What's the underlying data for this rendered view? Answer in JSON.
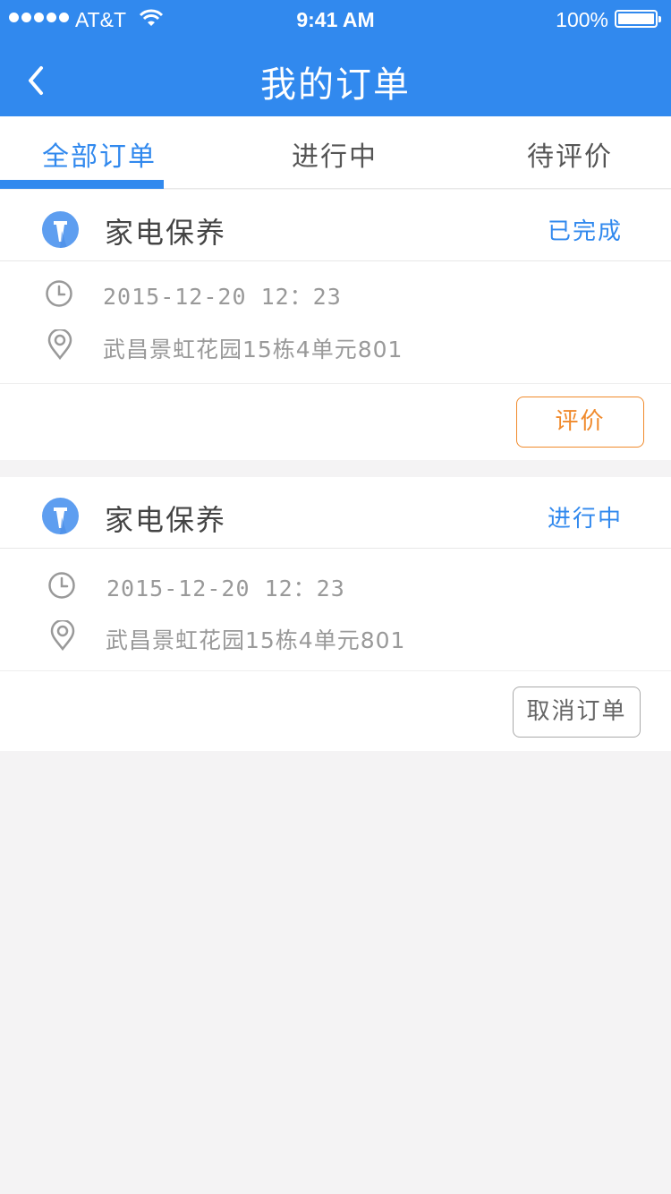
{
  "status_bar": {
    "carrier": "AT&T",
    "time": "9:41 AM",
    "battery": "100%"
  },
  "nav": {
    "title": "我的订单",
    "back_icon": "chevron-left-icon"
  },
  "tabs": [
    {
      "label": "全部订单",
      "active": true
    },
    {
      "label": "进行中",
      "active": false
    },
    {
      "label": "待评价",
      "active": false
    }
  ],
  "orders": [
    {
      "service": "家电保养",
      "status": "已完成",
      "datetime": "2015-12-20 12：23",
      "address": "武昌景虹花园15栋4单元801",
      "action": "评价"
    },
    {
      "service": "家电保养",
      "status": "进行中",
      "datetime": "2015-12-20 12：23",
      "address": "武昌景虹花园15栋4单元801",
      "action": "取消订单"
    }
  ],
  "colors": {
    "brand": "#3189ee",
    "rate_button": "#f08a2c",
    "background": "#f4f3f4"
  }
}
